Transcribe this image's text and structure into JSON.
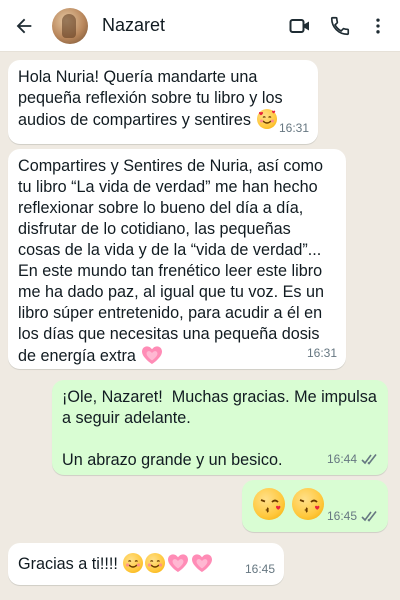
{
  "header": {
    "back_icon": "arrow-left-icon",
    "contact_name": "Nazaret",
    "video_icon": "video-call-icon",
    "phone_icon": "phone-icon",
    "menu_icon": "more-vert-icon"
  },
  "messages": [
    {
      "direction": "in",
      "text": "Hola Nuria! Quería mandarte una pequeña reflexión sobre tu libro y los audios de compartires y sentires",
      "emojis": [
        "smiling-face-with-hearts"
      ],
      "time": "16:31"
    },
    {
      "direction": "in",
      "text": "Compartires y Sentires de Nuria, así como tu libro “La vida de verdad” me han hecho reflexionar sobre lo bueno del día a día, disfrutar de lo cotidiano, las pequeñas cosas de la vida y de la “vida de verdad”... En este mundo tan frenético leer este libro me ha dado paz, al igual que tu voz. Es un libro súper entretenido, para acudir a él en los días que necesitas una pequeña dosis de energía extra",
      "emojis": [
        "growing-heart"
      ],
      "time": "16:31"
    },
    {
      "direction": "out",
      "text": "¡Ole, Nazaret!  Muchas gracias. Me impulsa a seguir adelante.\n\nUn abrazo grande y un besico.",
      "time": "16:44",
      "status": "read"
    },
    {
      "direction": "out",
      "text": "",
      "emojis": [
        "kissing-face-heart",
        "kissing-face-heart"
      ],
      "time": "16:45",
      "status": "read"
    },
    {
      "direction": "in",
      "text": "Gracias a ti!!!!",
      "emojis": [
        "smiling-face",
        "smiling-face",
        "growing-heart",
        "growing-heart"
      ],
      "time": "16:45"
    }
  ],
  "colors": {
    "incoming_bubble": "#ffffff",
    "outgoing_bubble": "#d9fdd3",
    "background": "#efeae2",
    "read_ticks": "#667781"
  }
}
